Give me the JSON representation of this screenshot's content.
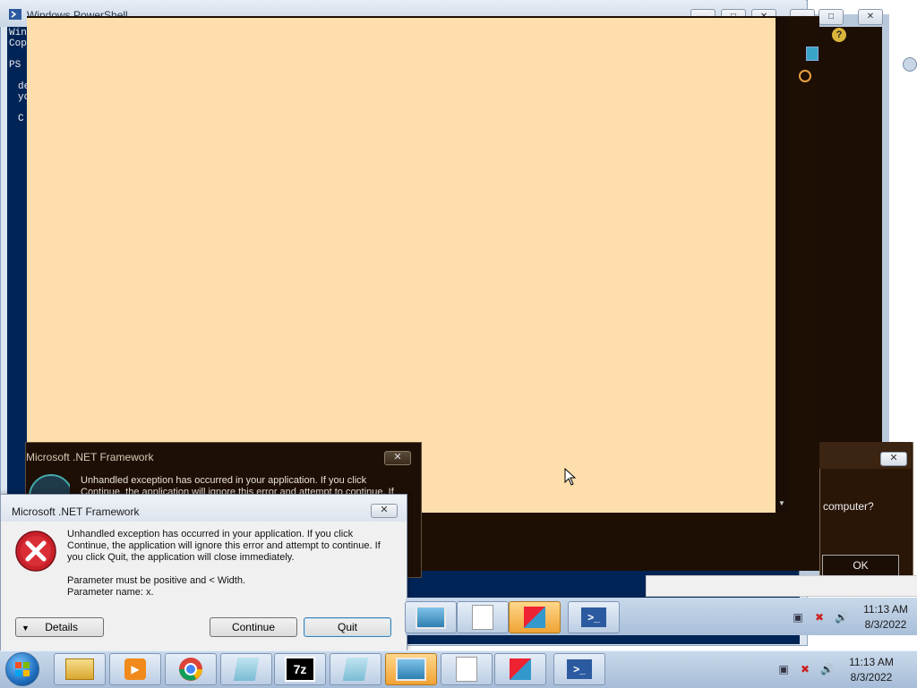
{
  "powershell": {
    "title": "Windows PowerShell",
    "lines": [
      "Win",
      "Cop",
      "PS",
      "de",
      "yo",
      "C"
    ]
  },
  "dialog_back": {
    "title": "Microsoft .NET Framework",
    "message": "Unhandled exception has occurred in your application. If you click Continue, the application will ignore this error and attempt to continue. If"
  },
  "dialog_front": {
    "title": "Microsoft .NET Framework",
    "message": "Unhandled exception has occurred in your application. If you click Continue, the application will ignore this error and attempt to continue. If you click Quit, the application will close immediately.",
    "param1": "Parameter must be positive and < Width.",
    "param2": "Parameter name: x.",
    "details_label": "Details",
    "continue_label": "Continue",
    "quit_label": "Quit",
    "close_label": "✕"
  },
  "dark_dialog": {
    "question": "computer?",
    "ok_label": "OK"
  },
  "taskbar": {
    "time": "11:13 AM",
    "date": "8/3/2022",
    "apps": [
      "windows-explorer",
      "media-player",
      "chrome",
      "notepad",
      "7zip",
      "notepad",
      "image-viewer",
      "text-document",
      "office-app",
      "powershell"
    ]
  },
  "taskbar_secondary": {
    "time": "11:13 AM",
    "date": "8/3/2022"
  }
}
